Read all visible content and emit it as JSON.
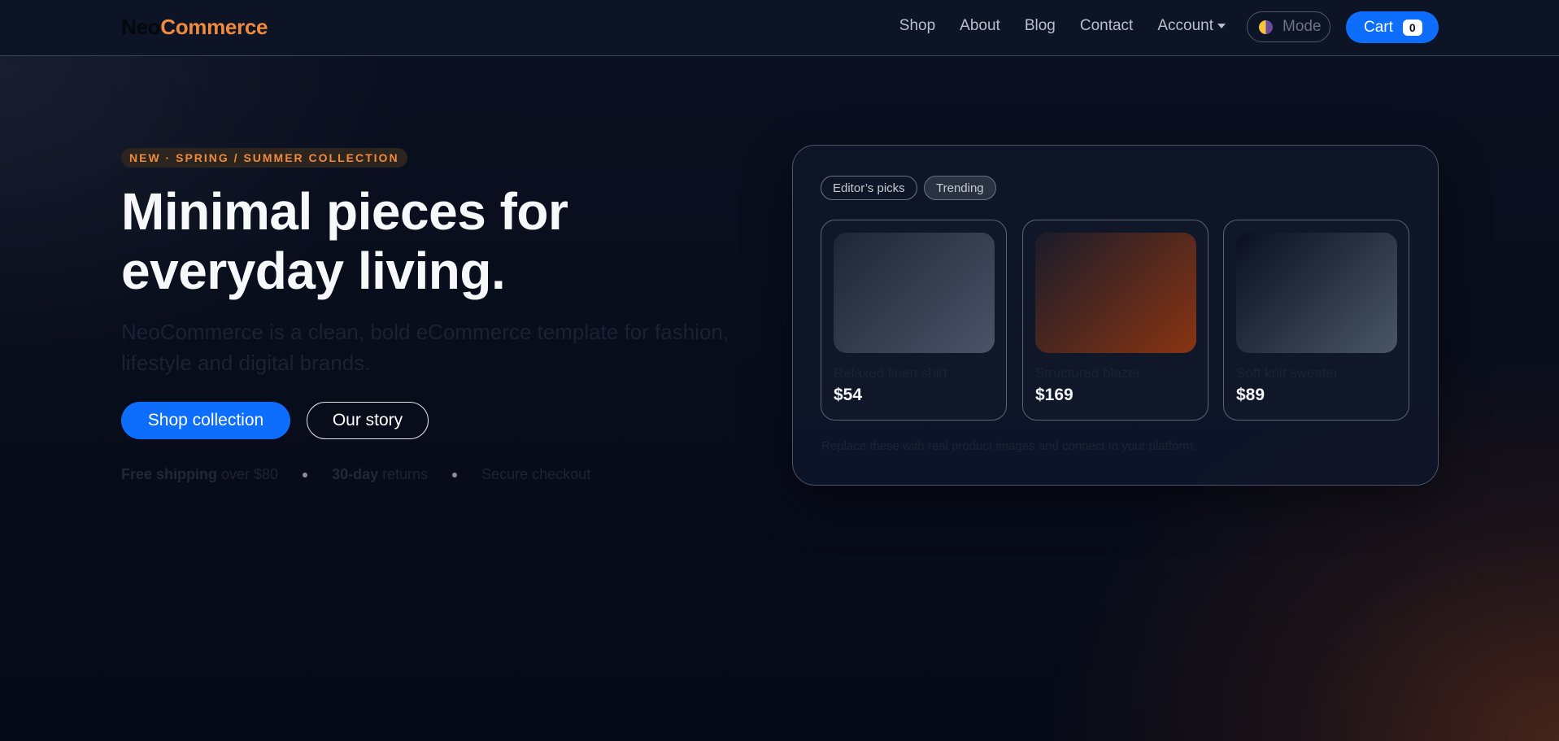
{
  "navbar": {
    "brand_part1": "Neo",
    "brand_part2": "Commerce",
    "links": [
      "Shop",
      "About",
      "Blog",
      "Contact",
      "Account"
    ],
    "mode_label": "Mode",
    "cart_label": "Cart",
    "cart_count": "0"
  },
  "hero": {
    "badge": "NEW · SPRING / SUMMER COLLECTION",
    "headline_line1": "Minimal pieces for",
    "headline_line2": "everyday living.",
    "subtext": "NeoCommerce is a clean, bold eCommerce template for fashion, lifestyle and digital brands.",
    "primary_button": "Shop collection",
    "secondary_button": "Our story",
    "perks": [
      {
        "strong": "Free shipping",
        "rest": " over $80"
      },
      {
        "strong": "30-day",
        "rest": " returns"
      },
      {
        "strong": "",
        "rest": "Secure checkout"
      }
    ]
  },
  "card": {
    "chips": [
      "Editor’s picks",
      "Trending"
    ],
    "products": [
      {
        "name": "Relaxed linen shirt",
        "price": "$54",
        "gradient_from": "#1e2636",
        "gradient_to": "#4a5466"
      },
      {
        "name": "Structured blazer",
        "price": "$169",
        "gradient_from": "#1a1c2a",
        "gradient_to": "#8a3412"
      },
      {
        "name": "Soft knit sweater",
        "price": "$89",
        "gradient_from": "#0a1020",
        "gradient_to": "#4a5666"
      }
    ],
    "note": "Replace these with real product images and connect to your platform."
  },
  "colors": {
    "accent_blue": "#0d6efd",
    "accent_orange": "#f08a3c"
  }
}
